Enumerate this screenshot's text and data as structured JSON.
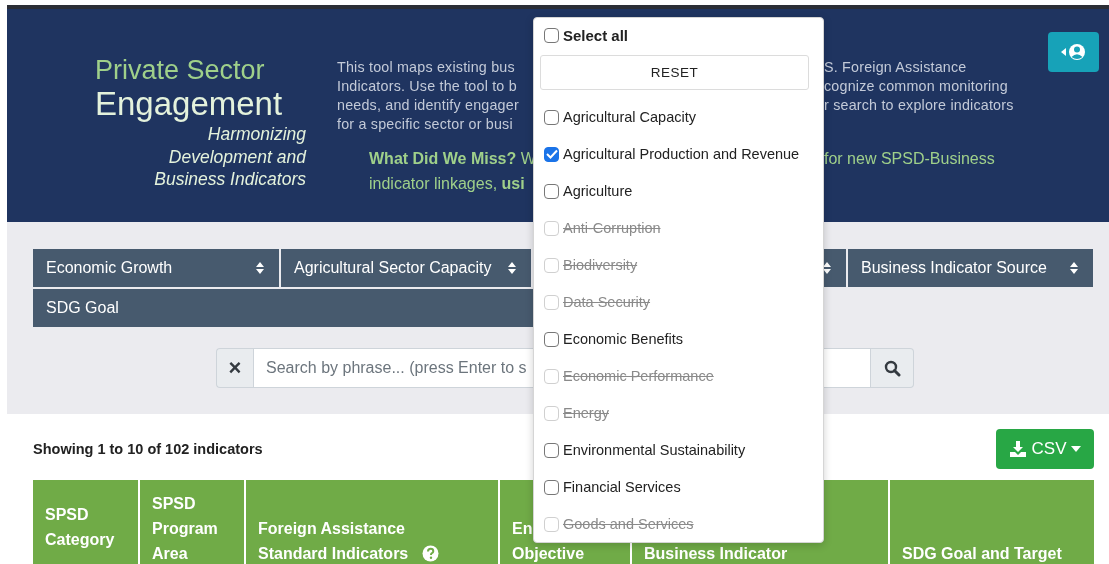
{
  "header": {
    "title_top": "Private Sector",
    "title_main": "Engagement",
    "subtitle_lines": [
      "Harmonizing",
      "Development and",
      "Business Indicators"
    ],
    "intro_left_lines": [
      "This tool maps existing bus",
      "Indicators. Use the tool to b",
      "needs, and identify engager",
      "for a specific sector or busi"
    ],
    "intro_right_lines": [
      "S. Foreign Assistance",
      "cognize common monitoring",
      "r search to explore indicators"
    ],
    "miss_left_lines": [
      "**What Did We Miss?** W",
      "indicator linkages, **usi**"
    ],
    "miss_right": "for new SPSD-Business"
  },
  "filters": [
    {
      "kind": "labelled",
      "label": "Economic Growth"
    },
    {
      "kind": "labelled",
      "label": "Agricultural Sector Capacity"
    },
    {
      "kind": "covered"
    },
    {
      "kind": "labelled",
      "label": "Business Indicator Source"
    }
  ],
  "filter_row2": {
    "label": "SDG Goal"
  },
  "search": {
    "clear": "×",
    "placeholder": "Search by phrase... (press Enter to s"
  },
  "summary": "Showing 1 to 10 of 102 indicators",
  "csv_button": "CSV",
  "table": {
    "columns": [
      {
        "lines": [
          "SPSD",
          "Category"
        ],
        "help": false
      },
      {
        "lines": [
          "SPSD",
          "Program",
          "Area"
        ],
        "help": false
      },
      {
        "lines": [
          "Foreign Assistance",
          "Standard Indicators"
        ],
        "help": true
      },
      {
        "lines": [
          "En",
          "Objective"
        ],
        "help": false
      },
      {
        "lines": [
          "Business Indicator"
        ],
        "help": false
      },
      {
        "lines": [
          "SDG Goal and Target"
        ],
        "help": false
      }
    ]
  },
  "dropdown": {
    "select_all": {
      "label": "Select all",
      "checked": false
    },
    "reset": "RESET",
    "options": [
      {
        "label": "Agricultural Capacity",
        "checked": false,
        "disabled": false
      },
      {
        "label": "Agricultural Production and Revenue",
        "checked": true,
        "disabled": false
      },
      {
        "label": "Agriculture",
        "checked": false,
        "disabled": false
      },
      {
        "label": "Anti-Corruption",
        "checked": false,
        "disabled": true
      },
      {
        "label": "Biodiversity",
        "checked": false,
        "disabled": true
      },
      {
        "label": "Data Security",
        "checked": false,
        "disabled": true
      },
      {
        "label": "Economic Benefits",
        "checked": false,
        "disabled": false
      },
      {
        "label": "Economic Performance",
        "checked": false,
        "disabled": true
      },
      {
        "label": "Energy",
        "checked": false,
        "disabled": true
      },
      {
        "label": "Environmental Sustainability",
        "checked": false,
        "disabled": false
      },
      {
        "label": "Financial Services",
        "checked": false,
        "disabled": false
      },
      {
        "label": "Goods and Services",
        "checked": false,
        "disabled": true
      }
    ]
  }
}
